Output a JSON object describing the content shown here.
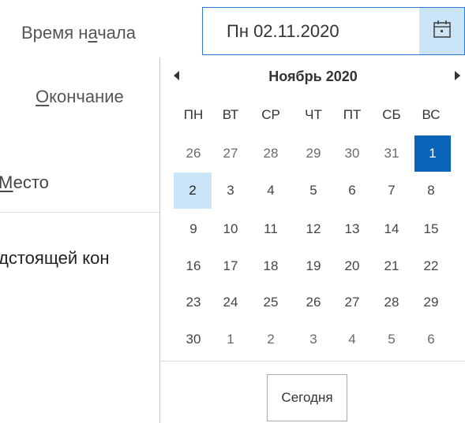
{
  "form": {
    "start_label_pre": "Время н",
    "start_label_u": "а",
    "start_label_post": "чала",
    "end_label_u": "О",
    "end_label_post": "кончание",
    "place_label_pre": "",
    "place_label_u": "М",
    "place_label_post": "есто",
    "meeting_text": "дстоящей кон"
  },
  "date_input": {
    "value": "Пн 02.11.2020",
    "icon": "calendar-icon"
  },
  "calendar": {
    "month_title": "Ноябрь 2020",
    "prev_icon": "triangle-left-icon",
    "next_icon": "triangle-right-icon",
    "weekdays": [
      "ПН",
      "ВТ",
      "СР",
      "ЧТ",
      "ПТ",
      "СБ",
      "ВС"
    ],
    "weeks": [
      [
        "26",
        "27",
        "28",
        "29",
        "30",
        "31",
        "1"
      ],
      [
        "2",
        "3",
        "4",
        "5",
        "6",
        "7",
        "8"
      ],
      [
        "9",
        "10",
        "11",
        "12",
        "13",
        "14",
        "15"
      ],
      [
        "16",
        "17",
        "18",
        "19",
        "20",
        "21",
        "22"
      ],
      [
        "23",
        "24",
        "25",
        "26",
        "27",
        "28",
        "29"
      ],
      [
        "30",
        "1",
        "2",
        "3",
        "4",
        "5",
        "6"
      ]
    ],
    "selected_day": "1",
    "highlighted_day": "2",
    "today_button": "Сегодня"
  },
  "colors": {
    "accent": "#0a64b8",
    "highlight": "#cce4f7",
    "input_border": "#2b7bd6"
  }
}
